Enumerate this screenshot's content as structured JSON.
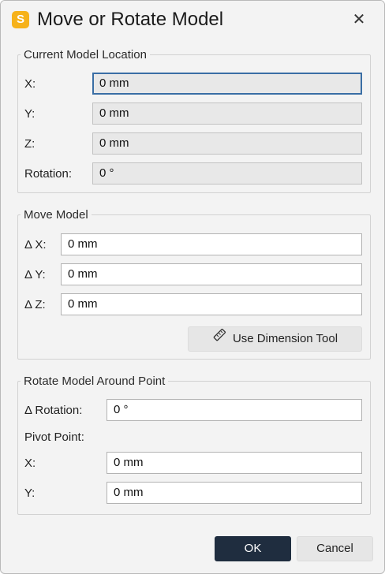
{
  "window": {
    "title": "Move or Rotate Model",
    "app_icon_letter": "S",
    "close_glyph": "✕"
  },
  "current_location": {
    "legend": "Current Model Location",
    "x_label": "X:",
    "x_value": "0 mm",
    "y_label": "Y:",
    "y_value": "0 mm",
    "z_label": "Z:",
    "z_value": "0 mm",
    "rotation_label": "Rotation:",
    "rotation_value": "0 °"
  },
  "move_model": {
    "legend": "Move Model",
    "dx_label": "Δ X:",
    "dx_value": "0 mm",
    "dy_label": "Δ Y:",
    "dy_value": "0 mm",
    "dz_label": "Δ Z:",
    "dz_value": "0 mm",
    "tool_button": "Use Dimension Tool"
  },
  "rotate_model": {
    "legend": "Rotate Model Around Point",
    "drotation_label": "Δ Rotation:",
    "drotation_value": "0 °",
    "pivot_label": "Pivot Point:",
    "pivot_x_label": "X:",
    "pivot_x_value": "0 mm",
    "pivot_y_label": "Y:",
    "pivot_y_value": "0 mm"
  },
  "footer": {
    "ok": "OK",
    "cancel": "Cancel"
  },
  "colors": {
    "accent": "#1f2d3f",
    "app_icon": "#f6b21b",
    "focus": "#3a6ea5"
  }
}
